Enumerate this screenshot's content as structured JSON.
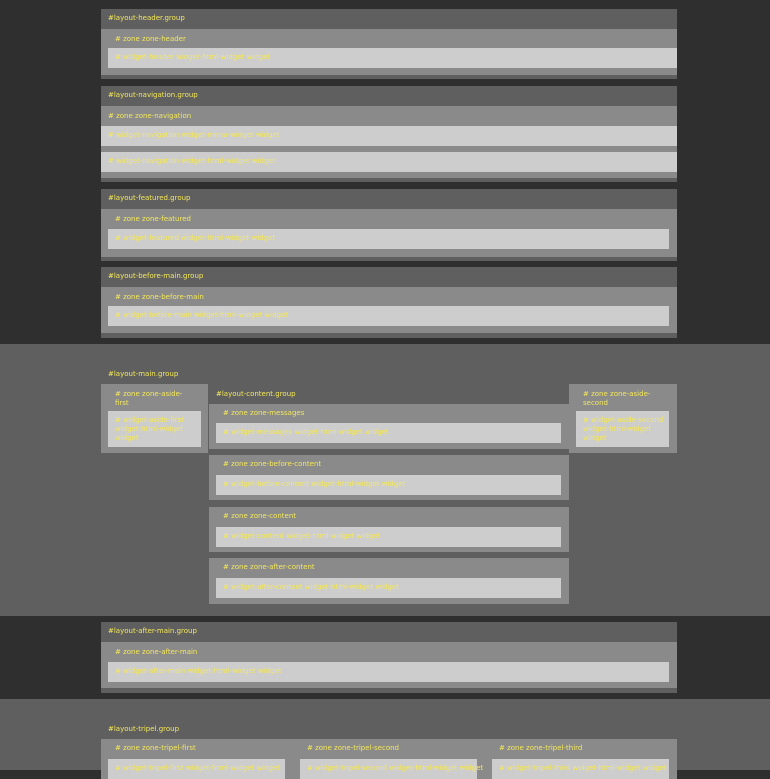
{
  "header_group": {
    "label": "#layout-header.group",
    "zone": "# zone zone-header",
    "widget": "# widget-header widget-html-widget widget"
  },
  "navigation_group": {
    "label": "#layout-navigation.group",
    "zone": "# zone zone-navigation",
    "widgets": [
      "# widget-navigation widget-menu-widget widget",
      "# widget-navigation widget-html-widget widget"
    ]
  },
  "featured_group": {
    "label": "#layout-featured.group",
    "zone": "# zone zone-featured",
    "widget": "# widget-featured widget-html-widget widget"
  },
  "before_main_group": {
    "label": "#layout-before-main.group",
    "zone": "# zone zone-before-main",
    "widget": "# widget-before-main widget-html-widget widget"
  },
  "main_group": {
    "label": "#layout-main.group",
    "aside_first": {
      "zone": "# zone zone-aside-first",
      "widget": "# widget-aside-first widget-html-widget widget"
    },
    "content_group": {
      "label": "#layout-content.group",
      "zones": [
        {
          "zone": "# zone zone-messages",
          "widget": "# widget-messages widget-html-widget widget"
        },
        {
          "zone": "# zone zone-before-content",
          "widget": "# widget-before-content widget-html-widget widget"
        },
        {
          "zone": "# zone zone-content",
          "widget": "# widget-content widget-html-widget widget"
        },
        {
          "zone": "# zone zone-after-content",
          "widget": "# widget-after-content widget-html-widget widget"
        }
      ]
    },
    "aside_second": {
      "zone": "# zone zone-aside-second",
      "widget": "# widget-aside-second widget-html-widget widget"
    }
  },
  "after_main_group": {
    "label": "#layout-after-main.group",
    "zone": "# zone zone-after-main",
    "widget": "# widget-after-main widget-html-widget widget"
  },
  "tripel_group": {
    "label": "#layout-tripel.group",
    "zones": [
      {
        "zone": "# zone zone-tripel-first",
        "widget": "# widget-tripel-first widget-html-widget widget"
      },
      {
        "zone": "# zone zone-tripel-second",
        "widget": "# widget-tripel-second widget-html-widget widget"
      },
      {
        "zone": "# zone zone-tripel-third",
        "widget": "# widget-tripel-third widget-html-widget widget"
      }
    ]
  },
  "colors": {
    "page_bg": "#2f2f2f",
    "band_bg": "#5f5f5f",
    "group_bg": "#5f5f5f",
    "zone_bg": "#8a8a8a",
    "widget_bg": "#cdcdcd",
    "label_text": "#f4e85a"
  }
}
